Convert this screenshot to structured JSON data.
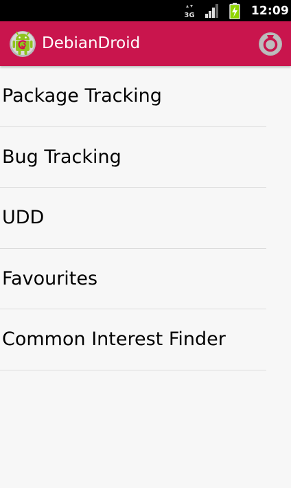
{
  "status_bar": {
    "network_type": "3G",
    "time": "12:09",
    "icons": [
      "network-3g-icon",
      "signal-strength-icon",
      "battery-charging-icon"
    ]
  },
  "action_bar": {
    "app_icon": "debian-android-logo",
    "title": "DebianDroid",
    "refresh_icon": "refresh-icon",
    "background_color": "#c9154d"
  },
  "menu": {
    "items": [
      {
        "label": "Package Tracking"
      },
      {
        "label": "Bug Tracking"
      },
      {
        "label": "UDD"
      },
      {
        "label": "Favourites"
      },
      {
        "label": "Common Interest Finder"
      }
    ]
  }
}
